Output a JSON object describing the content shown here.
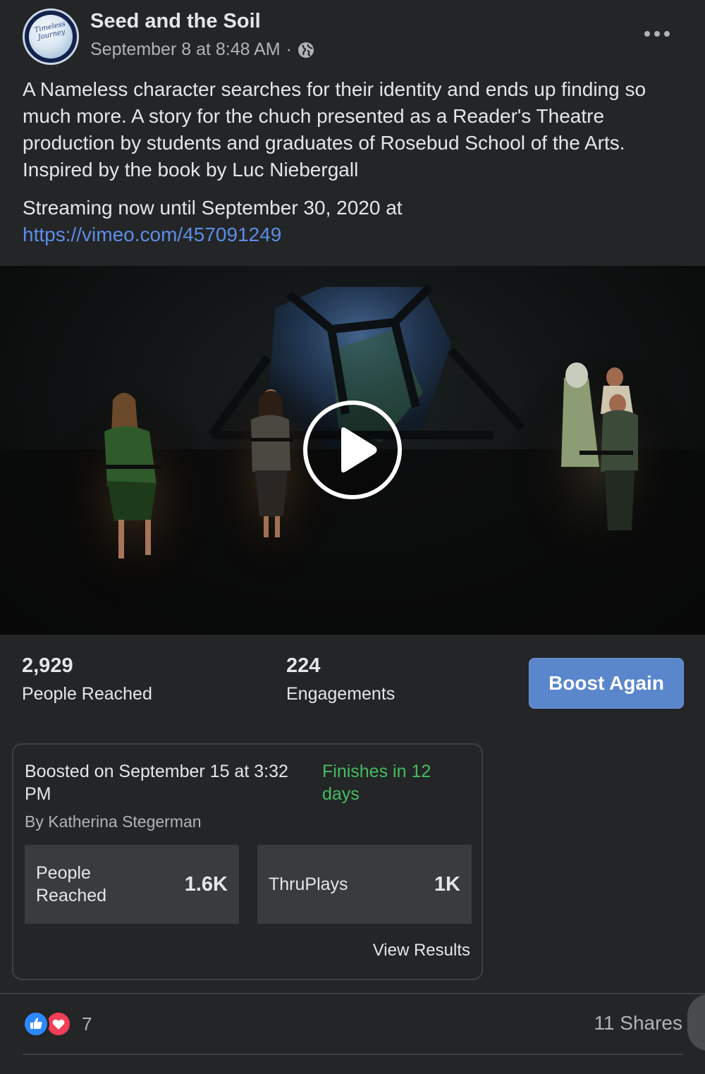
{
  "post": {
    "page_name": "Seed and the Soil",
    "timestamp": "September 8 at 8:48 AM",
    "meta_separator": "·",
    "audience_icon": "globe-icon",
    "more_icon": "more-options-icon",
    "text_paragraph_1": "A Nameless character searches for their identity and ends up finding so much more. A story for the chuch presented as a Reader's Theatre production by students and graduates of Rosebud School of the Arts. Inspired by the book by Luc Niebergall",
    "text_paragraph_2": "Streaming now until September 30, 2020 at",
    "link_text": "https://vimeo.com/457091249"
  },
  "video": {
    "play_icon": "play-icon"
  },
  "stats": {
    "people_reached_value": "2,929",
    "people_reached_label": "People Reached",
    "engagements_value": "224",
    "engagements_label": "Engagements",
    "boost_again_label": "Boost Again"
  },
  "boost_card": {
    "boosted_on": "Boosted on September 15 at 3:32 PM",
    "status": "Finishes in 12 days",
    "by": "By Katherina Stegerman",
    "metrics": [
      {
        "label": "People Reached",
        "value": "1.6K"
      },
      {
        "label": "ThruPlays",
        "value": "1K"
      }
    ],
    "view_results_label": "View Results"
  },
  "footer": {
    "reaction_count": "7",
    "shares": "11 Shares"
  },
  "colors": {
    "background": "#242526",
    "link": "#5b8ee8",
    "boost_button": "#5a86cc",
    "status_green": "#45bd62",
    "like_blue": "#2d88ff",
    "love_red": "#f33e58"
  }
}
